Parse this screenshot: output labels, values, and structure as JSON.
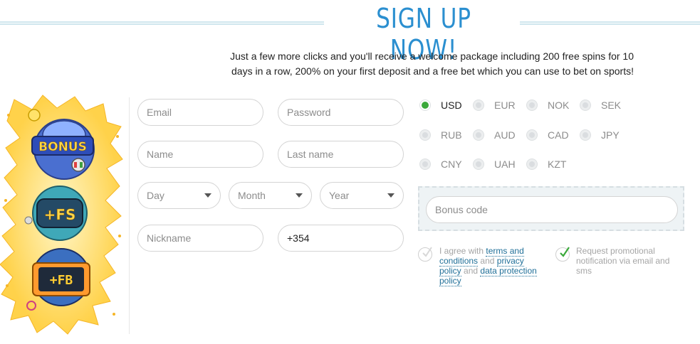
{
  "header": {
    "title": "SIGN UP NOW!",
    "intro_line1": "Just a few more clicks and you'll receive a welcome package including 200 free spins for 10",
    "intro_line2": "days in a row, 200% on your first deposit and a free bet which you can use to bet on sports!"
  },
  "artwork": {
    "bonus_label": "BONUS",
    "fs_label": "+FS",
    "fb_label": "+FB"
  },
  "form": {
    "email_placeholder": "Email",
    "password_placeholder": "Password",
    "name_placeholder": "Name",
    "lastname_placeholder": "Last name",
    "day_label": "Day",
    "month_label": "Month",
    "year_label": "Year",
    "nickname_placeholder": "Nickname",
    "phone_value": "+354"
  },
  "currencies": {
    "selected": "USD",
    "items": [
      "USD",
      "EUR",
      "NOK",
      "SEK",
      "RUB",
      "AUD",
      "CAD",
      "JPY",
      "CNY",
      "UAH",
      "KZT"
    ]
  },
  "bonus": {
    "placeholder": "Bonus code"
  },
  "consent": {
    "agree_prefix": "I agree with",
    "terms_link": "terms and conditions",
    "and1": "and",
    "privacy_link": "privacy policy",
    "and2": "and",
    "data_link": "data protection policy",
    "promo_text": "Request promotional notification via email and sms"
  },
  "colors": {
    "title": "#2b8fd0",
    "accent_green": "#3aa83a",
    "link": "#1f6f98"
  }
}
